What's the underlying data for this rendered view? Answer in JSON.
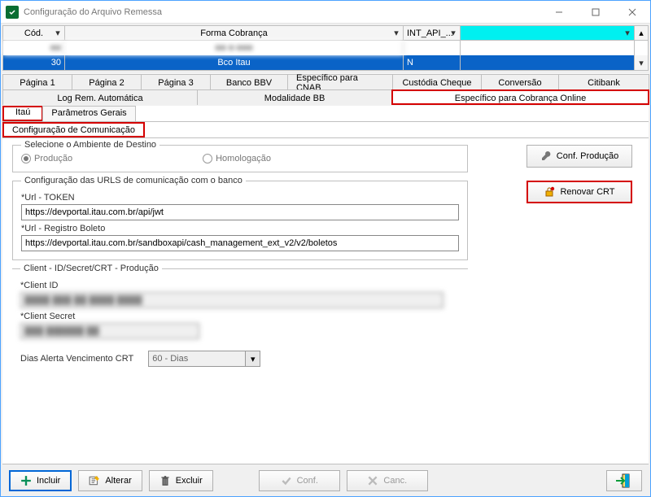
{
  "window": {
    "title": "Configuração do Arquivo Remessa"
  },
  "grid": {
    "headers": {
      "cod": "Cód.",
      "forma": "Forma Cobrança",
      "int": "INT_API_..."
    },
    "row1": {
      "cod": "",
      "forma": "",
      "int": ""
    },
    "row2": {
      "cod": "30",
      "forma": "Bco Itau",
      "int": "N"
    }
  },
  "tabs_row1": {
    "t1": "Página 1",
    "t2": "Página 2",
    "t3": "Página 3",
    "t4": "Banco BBV",
    "t5": "Específico para CNAB",
    "t6": "Custódia Cheque",
    "t7": "Conversão",
    "t8": "Citibank"
  },
  "tabs_row2": {
    "t1": "Log Rem. Automática",
    "t2": "Modalidade BB",
    "t3": "Específico para Cobrança Online"
  },
  "tabs_row3": {
    "t1": "Itaú",
    "t2": "Parâmetros Gerais"
  },
  "tabs_row4": {
    "t1": "Configuração de Comunicação"
  },
  "env": {
    "legend": "Selecione o Ambiente de Destino",
    "prod": "Produção",
    "homolog": "Homologação"
  },
  "urls": {
    "legend": "Configuração das URLS de comunicação com o banco",
    "token_label": "*Url - TOKEN",
    "token_value": "https://devportal.itau.com.br/api/jwt",
    "boleto_label": "*Url - Registro Boleto",
    "boleto_value": "https://devportal.itau.com.br/sandboxapi/cash_management_ext_v2/v2/boletos"
  },
  "client": {
    "legend": "Client - ID/Secret/CRT  - Produção",
    "id_label": "*Client ID",
    "id_value": "",
    "secret_label": "*Client Secret",
    "secret_value": "",
    "dias_label": "Dias Alerta Vencimento CRT",
    "dias_value": "60 - Dias"
  },
  "side": {
    "conf": "Conf. Produção",
    "renovar": "Renovar CRT"
  },
  "bottom": {
    "incluir": "Incluir",
    "alterar": "Alterar",
    "excluir": "Excluir",
    "conf": "Conf.",
    "canc": "Canc."
  }
}
